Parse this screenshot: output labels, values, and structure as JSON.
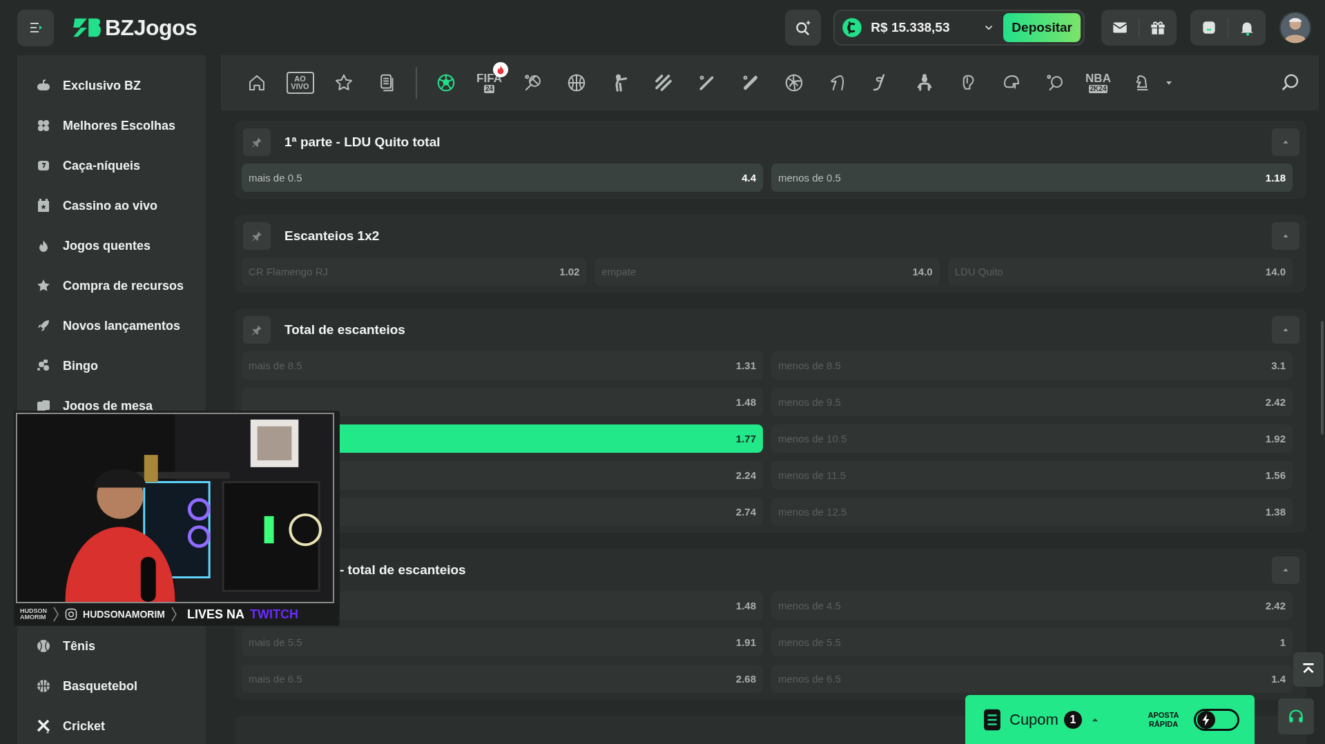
{
  "header": {
    "brand": "BZJogos",
    "balance": "R$ 15.338,53",
    "deposit_button": "Depositar"
  },
  "sidebar": {
    "items": [
      {
        "label": "Exclusivo BZ"
      },
      {
        "label": "Melhores Escolhas"
      },
      {
        "label": "Caça-níqueis"
      },
      {
        "label": "Cassino ao vivo"
      },
      {
        "label": "Jogos quentes"
      },
      {
        "label": "Compra de recursos"
      },
      {
        "label": "Novos lançamentos"
      },
      {
        "label": "Bingo"
      },
      {
        "label": "Jogos de mesa"
      }
    ],
    "lower_items": [
      {
        "label": "Tênis"
      },
      {
        "label": "Basquetebol"
      },
      {
        "label": "Cricket"
      }
    ]
  },
  "sport_tabs": [
    {
      "kind": "icon",
      "selected": false,
      "hot": false
    },
    {
      "kind": "text",
      "label": "AO VIVO",
      "selected": false,
      "hot": false
    },
    {
      "kind": "icon",
      "selected": false,
      "hot": false
    },
    {
      "kind": "icon",
      "selected": false,
      "hot": false
    },
    {
      "kind": "separator"
    },
    {
      "kind": "icon",
      "selected": true,
      "hot": false
    },
    {
      "kind": "text",
      "label": "FIFA",
      "sub": "24",
      "selected": false,
      "hot": true
    },
    {
      "kind": "icon",
      "selected": false,
      "hot": false
    },
    {
      "kind": "icon",
      "selected": false,
      "hot": false
    },
    {
      "kind": "icon",
      "selected": false,
      "hot": false
    },
    {
      "kind": "icon",
      "selected": false,
      "hot": false
    },
    {
      "kind": "icon",
      "selected": false,
      "hot": false
    },
    {
      "kind": "icon",
      "selected": false,
      "hot": false
    },
    {
      "kind": "icon",
      "selected": false,
      "hot": false
    },
    {
      "kind": "icon",
      "selected": false,
      "hot": false
    },
    {
      "kind": "icon",
      "selected": false,
      "hot": false
    },
    {
      "kind": "icon",
      "selected": false,
      "hot": false
    },
    {
      "kind": "icon",
      "selected": false,
      "hot": false
    },
    {
      "kind": "icon",
      "selected": false,
      "hot": false
    },
    {
      "kind": "icon",
      "selected": false,
      "hot": false
    },
    {
      "kind": "text",
      "label": "NBA",
      "sub": "2K24",
      "selected": false,
      "hot": false
    },
    {
      "kind": "icon",
      "selected": false,
      "hot": false
    }
  ],
  "markets": [
    {
      "title": "1ª parte - LDU Quito total",
      "expanded": true,
      "covered": false,
      "rows": [
        [
          {
            "label": "mais de 0.5",
            "odds": "4.4",
            "selected": false,
            "disabled": false
          },
          {
            "label": "menos de 0.5",
            "odds": "1.18",
            "selected": false,
            "disabled": false
          }
        ]
      ]
    },
    {
      "title": "Escanteios 1x2",
      "expanded": true,
      "covered": false,
      "rows": [
        [
          {
            "label": "CR Flamengo RJ",
            "odds": "1.02",
            "selected": false,
            "disabled": true
          },
          {
            "label": "empate",
            "odds": "14.0",
            "selected": false,
            "disabled": true
          },
          {
            "label": "LDU Quito",
            "odds": "14.0",
            "selected": false,
            "disabled": true
          }
        ]
      ]
    },
    {
      "title": "Total de escanteios",
      "expanded": true,
      "covered": false,
      "rows": [
        [
          {
            "label": "mais de 8.5",
            "odds": "1.31",
            "selected": false,
            "disabled": true
          },
          {
            "label": "menos de 8.5",
            "odds": "3.1",
            "selected": false,
            "disabled": true
          }
        ],
        [
          {
            "odds": "1.48",
            "selected": false,
            "disabled": true
          },
          {
            "label": "menos de 9.5",
            "odds": "2.42",
            "selected": false,
            "disabled": true
          }
        ],
        [
          {
            "odds": "1.77",
            "selected": true,
            "disabled": true
          },
          {
            "label": "menos de 10.5",
            "odds": "1.92",
            "selected": false,
            "disabled": true
          }
        ],
        [
          {
            "odds": "2.24",
            "selected": false,
            "disabled": true
          },
          {
            "label": "menos de 11.5",
            "odds": "1.56",
            "selected": false,
            "disabled": true
          }
        ],
        [
          {
            "odds": "2.74",
            "selected": false,
            "disabled": true
          },
          {
            "label": "menos de 12.5",
            "odds": "1.38",
            "selected": false,
            "disabled": true
          }
        ]
      ]
    },
    {
      "title": "- total de escanteios",
      "expanded": true,
      "covered": true,
      "rows": [
        [
          {
            "odds": "1.48",
            "selected": false,
            "disabled": true
          },
          {
            "label": "menos de 4.5",
            "odds": "2.42",
            "selected": false,
            "disabled": true
          }
        ],
        [
          {
            "label": "mais de 5.5",
            "odds": "1.91",
            "selected": false,
            "disabled": true
          },
          {
            "label": "menos de 5.5",
            "odds": "1",
            "selected": false,
            "disabled": true
          }
        ],
        [
          {
            "label": "mais de 6.5",
            "odds": "2.68",
            "selected": false,
            "disabled": true
          },
          {
            "label": "menos de 6.5",
            "odds": "1.4",
            "selected": false,
            "disabled": true
          }
        ]
      ]
    }
  ],
  "coupon": {
    "label": "Cupom",
    "count": "1",
    "quick_bet_label": "APOSTA RÁPIDA",
    "quick_bet_on": false
  },
  "stream_overlay": {
    "logo_lines": [
      "HUDSON",
      "AMORIM"
    ],
    "handle": "HUDSONAMORIM",
    "tagline": "LIVES NA",
    "platform": "TWITCH"
  }
}
